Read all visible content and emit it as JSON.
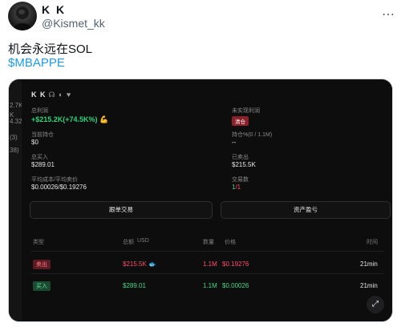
{
  "tweet": {
    "display_name": "K K",
    "handle": "@Kismet_kk",
    "more_icon": "ellipsis-icon",
    "text": "机会永远在SOL",
    "ticker": "$MBAPPE"
  },
  "side_strip": [
    "2.7K",
    "K",
    "4.32",
    "(3)",
    "38)"
  ],
  "card": {
    "title": "K K",
    "title_icons": "☊ ◐ ♥",
    "total_pnl_label": "总利润",
    "total_pnl_value": "+$215.2K(+74.5K%)",
    "total_pnl_emoji": "💪",
    "unrealized_label": "未实现利润",
    "unrealized_badge": "清仓",
    "position_label": "当前持仓",
    "position_value": "$0",
    "holding_pct_label": "持仓%(0 / 1.1M)",
    "holding_pct_value": "--",
    "total_bought_label": "总买入",
    "total_bought_value": "$289.01",
    "sold_label": "已卖出",
    "sold_value": "$215.5K",
    "avg_label": "平均成本/平均卖价",
    "avg_value": "$0.00026/$0.19276",
    "trades_label": "交易数",
    "trades_buy": "1",
    "trades_sell": "/1",
    "copy_trade_button": "跟单交易",
    "asset_pnl_button": "资产盈亏",
    "table": {
      "headers": [
        "类型",
        "总额",
        "USD",
        "数量",
        "价格",
        "时间"
      ],
      "rows": [
        {
          "type": "卖出",
          "total": "$215.5K",
          "qty": "1.1M",
          "price": "$0.19276",
          "time": "21min"
        },
        {
          "type": "买入",
          "total": "$289.01",
          "qty": "1.1M",
          "price": "$0.00026",
          "time": "21min"
        }
      ]
    }
  },
  "colors": {
    "link": "#1d9bf0",
    "profit_green": "#2fd27c",
    "loss_red": "#ff4d6a"
  }
}
